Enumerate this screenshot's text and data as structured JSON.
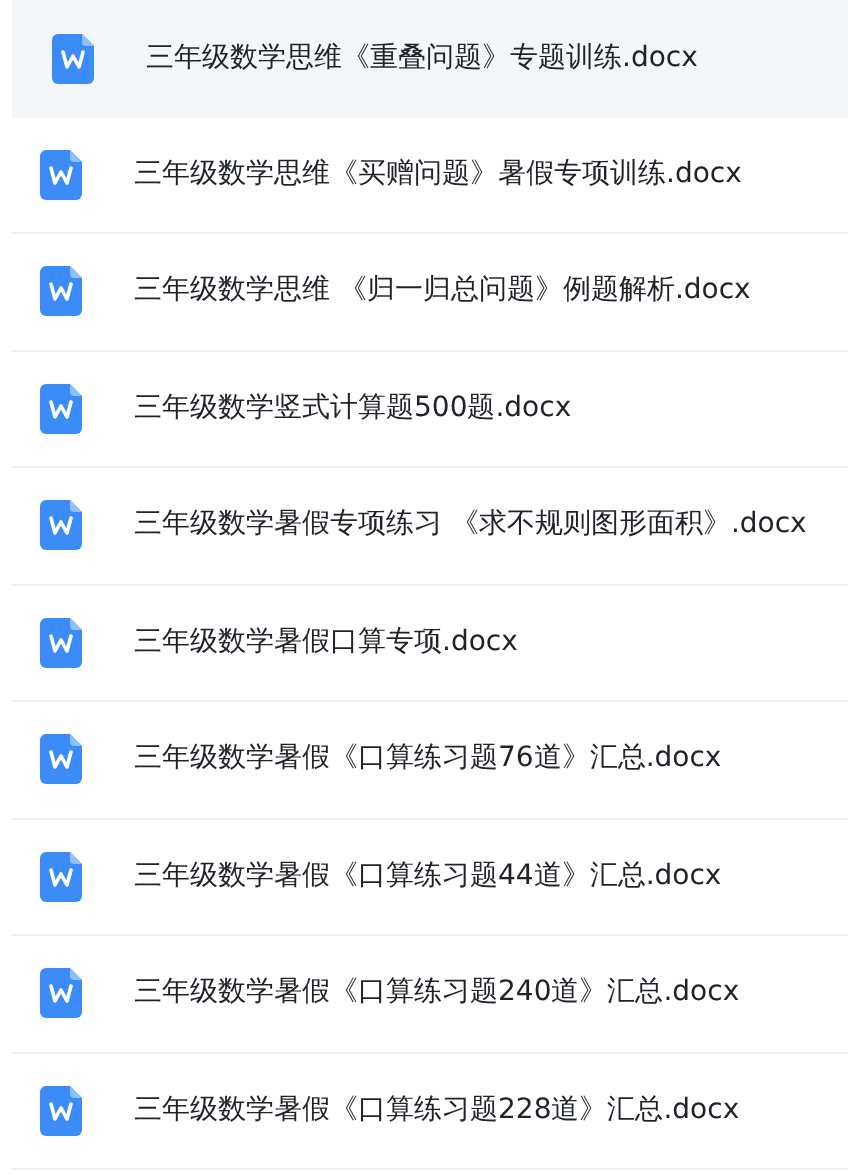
{
  "files": [
    {
      "name": "三年级数学思维《重叠问题》专题训练.docx",
      "selected": true
    },
    {
      "name": "三年级数学思维《买赠问题》暑假专项训练.docx",
      "selected": false
    },
    {
      "name": "三年级数学思维 《归一归总问题》例题解析.docx",
      "selected": false
    },
    {
      "name": "三年级数学竖式计算题500题.docx",
      "selected": false
    },
    {
      "name": "三年级数学暑假专项练习 《求不规则图形面积》.docx",
      "selected": false
    },
    {
      "name": "三年级数学暑假口算专项.docx",
      "selected": false
    },
    {
      "name": "三年级数学暑假《口算练习题76道》汇总.docx",
      "selected": false
    },
    {
      "name": "三年级数学暑假《口算练习题44道》汇总.docx",
      "selected": false
    },
    {
      "name": "三年级数学暑假《口算练习题240道》汇总.docx",
      "selected": false
    },
    {
      "name": "三年级数学暑假《口算练习题228道》汇总.docx",
      "selected": false
    }
  ]
}
